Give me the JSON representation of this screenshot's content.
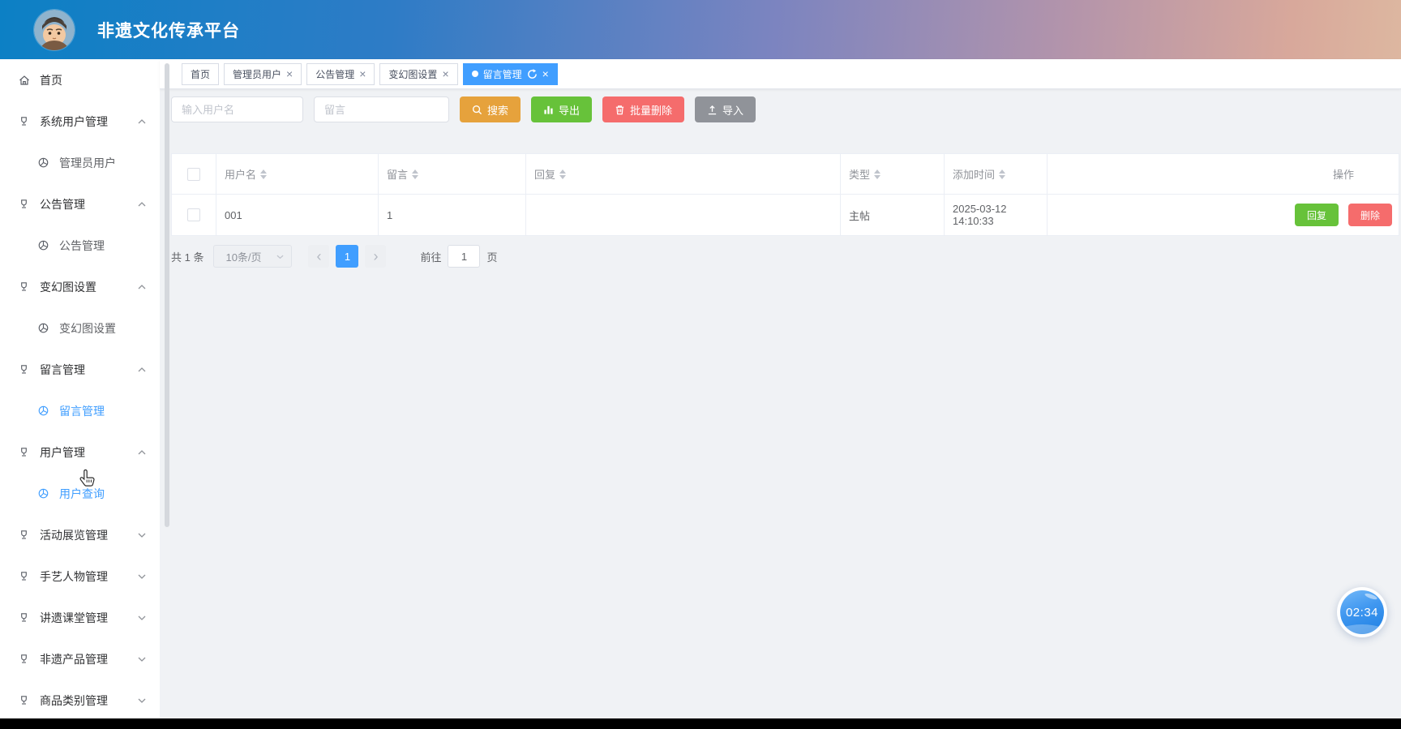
{
  "header": {
    "title": "非遗文化传承平台"
  },
  "sidebar": {
    "items": [
      {
        "label": "首页"
      },
      {
        "label": "系统用户管理"
      },
      {
        "label": "管理员用户"
      },
      {
        "label": "公告管理"
      },
      {
        "label": "公告管理"
      },
      {
        "label": "变幻图设置"
      },
      {
        "label": "变幻图设置"
      },
      {
        "label": "留言管理"
      },
      {
        "label": "留言管理"
      },
      {
        "label": "用户管理"
      },
      {
        "label": "用户查询"
      },
      {
        "label": "活动展览管理"
      },
      {
        "label": "手艺人物管理"
      },
      {
        "label": "讲遗课堂管理"
      },
      {
        "label": "非遗产品管理"
      },
      {
        "label": "商品类别管理"
      }
    ]
  },
  "tabs": [
    {
      "label": "首页"
    },
    {
      "label": "管理员用户"
    },
    {
      "label": "公告管理"
    },
    {
      "label": "变幻图设置"
    },
    {
      "label": "留言管理"
    }
  ],
  "toolbar": {
    "username_placeholder": "输入用户名",
    "message_placeholder": "留言",
    "search_label": "搜索",
    "export_label": "导出",
    "batch_delete_label": "批量删除",
    "import_label": "导入"
  },
  "table": {
    "columns": [
      "用户名",
      "留言",
      "回复",
      "类型",
      "添加时间",
      "操作"
    ],
    "rows": [
      {
        "username": "001",
        "message": "1",
        "reply": "",
        "type": "主帖",
        "added_time": "2025-03-12 14:10:33",
        "reply_label": "回复",
        "delete_label": "删除"
      }
    ]
  },
  "pagination": {
    "total_text": "共 1 条",
    "page_size": "10条/页",
    "current_page": "1",
    "goto_label": "前往",
    "goto_value": "1",
    "page_suffix": "页"
  },
  "timer": {
    "value": "02:34"
  },
  "colors": {
    "accent": "#409EFF",
    "search_btn": "#E6A23C",
    "export_btn": "#67C23A",
    "delete_btn": "#F56C6C",
    "import_btn": "#909399"
  }
}
